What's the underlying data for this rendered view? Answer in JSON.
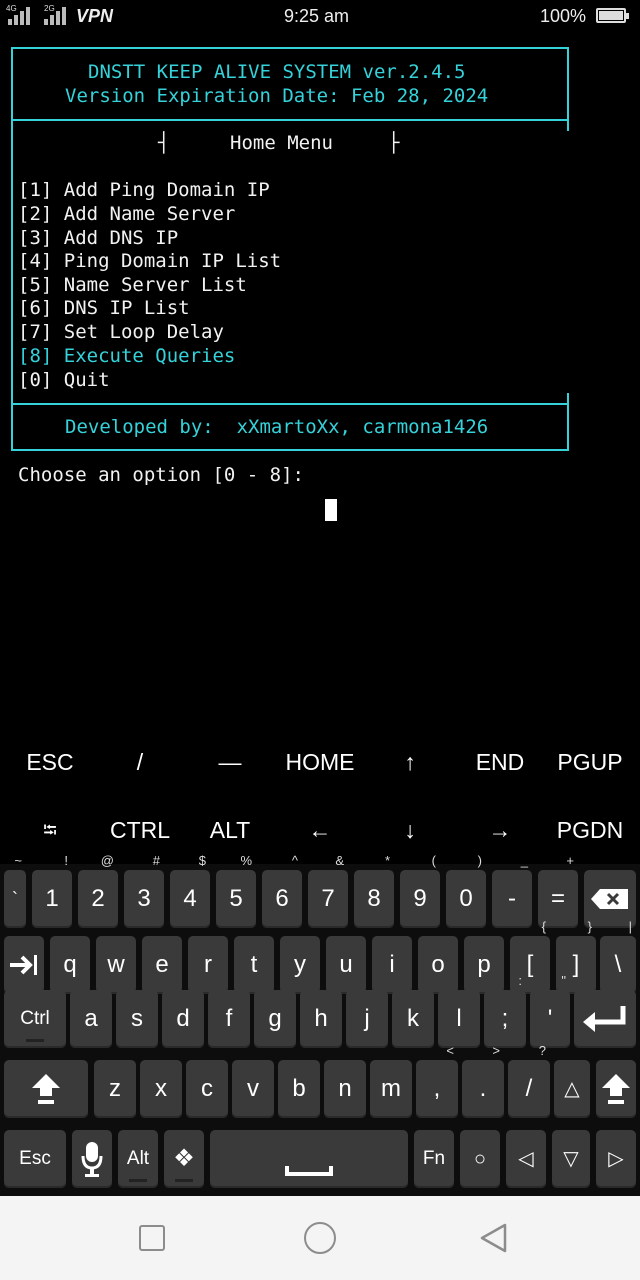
{
  "status_bar": {
    "net_left": "4G",
    "net_right": "2G",
    "vpn": "VPN",
    "time": "9:25 am",
    "battery": "100%"
  },
  "terminal": {
    "title_line1": "DNSTT KEEP ALIVE SYSTEM ver.2.4.5",
    "title_line2": "Version Expiration Date: Feb 28, 2024",
    "menu_left_glyph": "┤",
    "menu_title": "Home Menu",
    "menu_right_glyph": "├",
    "menu_items": [
      "[1] Add Ping Domain IP",
      "[2] Add Name Server",
      "[3] Add DNS IP",
      "[4] Ping Domain IP List",
      "[5] Name Server List",
      "[6] DNS IP List",
      "[7] Set Loop Delay",
      "[8] Execute Queries",
      "[0] Quit"
    ],
    "footer": "Developed by:  xXmartoXx, carmona1426",
    "prompt": "Choose an option [0 - 8]: "
  },
  "extra_keys": {
    "row1": [
      "ESC",
      "/",
      "—",
      "HOME",
      "↑",
      "END",
      "PGUP"
    ],
    "row2": [
      "⭾",
      "CTRL",
      "ALT",
      "←",
      "↓",
      "→",
      "PGDN"
    ]
  },
  "keyboard": {
    "row1": [
      {
        "k": "`",
        "s": "~"
      },
      {
        "k": "1",
        "s": "!"
      },
      {
        "k": "2",
        "s": "@"
      },
      {
        "k": "3",
        "s": "#"
      },
      {
        "k": "4",
        "s": "$"
      },
      {
        "k": "5",
        "s": "%"
      },
      {
        "k": "6",
        "s": "^"
      },
      {
        "k": "7",
        "s": "&"
      },
      {
        "k": "8",
        "s": "*"
      },
      {
        "k": "9",
        "s": "("
      },
      {
        "k": "0",
        "s": ")"
      },
      {
        "k": "-",
        "s": "_"
      },
      {
        "k": "=",
        "s": "+"
      },
      {
        "k": "⌫",
        "s": ""
      }
    ],
    "row2": [
      {
        "k": "⇥",
        "s": ""
      },
      {
        "k": "q",
        "s": ""
      },
      {
        "k": "w",
        "s": ""
      },
      {
        "k": "e",
        "s": ""
      },
      {
        "k": "r",
        "s": ""
      },
      {
        "k": "t",
        "s": ""
      },
      {
        "k": "y",
        "s": ""
      },
      {
        "k": "u",
        "s": ""
      },
      {
        "k": "i",
        "s": ""
      },
      {
        "k": "o",
        "s": ""
      },
      {
        "k": "p",
        "s": ""
      },
      {
        "k": "[",
        "s": "{"
      },
      {
        "k": "]",
        "s": "}"
      },
      {
        "k": "\\",
        "s": "|"
      }
    ],
    "row3": [
      {
        "k": "Ctrl",
        "s": ""
      },
      {
        "k": "a",
        "s": ""
      },
      {
        "k": "s",
        "s": ""
      },
      {
        "k": "d",
        "s": ""
      },
      {
        "k": "f",
        "s": ""
      },
      {
        "k": "g",
        "s": ""
      },
      {
        "k": "h",
        "s": ""
      },
      {
        "k": "j",
        "s": ""
      },
      {
        "k": "k",
        "s": ""
      },
      {
        "k": "l",
        "s": ""
      },
      {
        "k": ";",
        "s": ":"
      },
      {
        "k": "'",
        "s": "\""
      },
      {
        "k": "↵",
        "s": ""
      }
    ],
    "row4": [
      {
        "k": "⇧",
        "s": ""
      },
      {
        "k": "z",
        "s": ""
      },
      {
        "k": "x",
        "s": ""
      },
      {
        "k": "c",
        "s": ""
      },
      {
        "k": "v",
        "s": ""
      },
      {
        "k": "b",
        "s": ""
      },
      {
        "k": "n",
        "s": ""
      },
      {
        "k": "m",
        "s": ""
      },
      {
        "k": ",",
        "s": "<"
      },
      {
        "k": ".",
        "s": ">"
      },
      {
        "k": "/",
        "s": "?"
      },
      {
        "k": "△",
        "s": ""
      },
      {
        "k": "⇧",
        "s": ""
      }
    ],
    "row5": [
      {
        "k": "Esc",
        "s": ""
      },
      {
        "k": "🎤",
        "s": ""
      },
      {
        "k": "Alt",
        "s": ""
      },
      {
        "k": "❖",
        "s": ""
      },
      {
        "k": "␣",
        "s": ""
      },
      {
        "k": "Fn",
        "s": ""
      },
      {
        "k": "○",
        "s": ""
      },
      {
        "k": "◁",
        "s": ""
      },
      {
        "k": "▽",
        "s": ""
      },
      {
        "k": "▷",
        "s": ""
      }
    ]
  },
  "colors": {
    "accent": "#35d2da",
    "terminal_bg": "#000000",
    "key_bg": "#3a3a3a"
  }
}
